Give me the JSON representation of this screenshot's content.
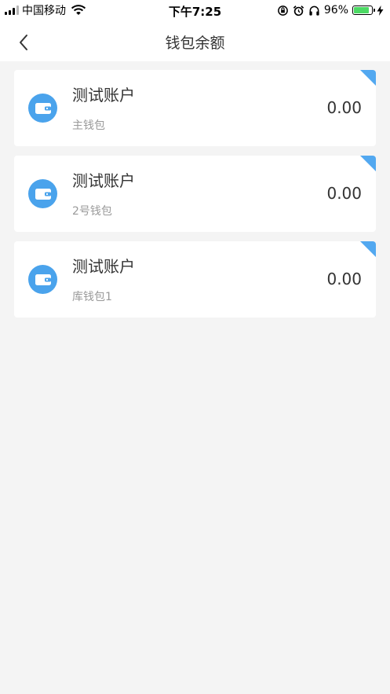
{
  "status_bar": {
    "carrier": "中国移动",
    "time": "下午7:25",
    "battery_percent_text": "96%",
    "battery_level": 0.96,
    "battery_color": "#4cd964",
    "icons": [
      "signal-icon",
      "wifi-icon",
      "rotation-lock-icon",
      "alarm-icon",
      "headphones-icon",
      "battery-icon",
      "charging-icon"
    ]
  },
  "nav": {
    "title": "钱包余额",
    "back_icon": "chevron-left-icon"
  },
  "accent_color": "#52a8f0",
  "wallets": [
    {
      "account": "测试账户",
      "wallet_name": "主钱包",
      "balance": "0.00"
    },
    {
      "account": "测试账户",
      "wallet_name": "2号钱包",
      "balance": "0.00"
    },
    {
      "account": "测试账户",
      "wallet_name": "库钱包1",
      "balance": "0.00"
    }
  ]
}
